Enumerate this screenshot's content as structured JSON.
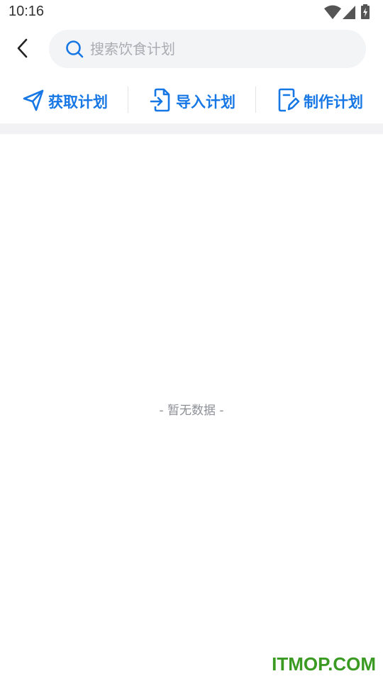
{
  "status_bar": {
    "time": "10:16",
    "icons": [
      "wifi-icon",
      "cell-signal-icon",
      "battery-charging-icon"
    ]
  },
  "header": {
    "back_icon": "chevron-left-icon",
    "search": {
      "placeholder": "搜索饮食计划",
      "value": "",
      "icon": "search-icon"
    }
  },
  "actions": [
    {
      "label": "获取计划",
      "icon": "send-icon"
    },
    {
      "label": "导入计划",
      "icon": "import-file-icon"
    },
    {
      "label": "制作计划",
      "icon": "edit-document-icon"
    }
  ],
  "main": {
    "empty_text": "- 暂无数据 -"
  },
  "watermark": "ITMOP.COM",
  "colors": {
    "accent": "#1677e5",
    "search_bg": "#f3f4f6",
    "watermark": "#3a9a22"
  }
}
